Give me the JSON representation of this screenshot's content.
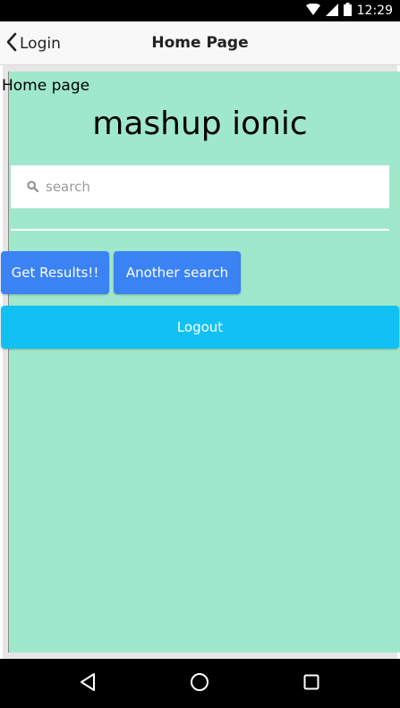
{
  "status_bar": {
    "time": "12:29",
    "icons": [
      "wifi-icon",
      "signal-icon",
      "battery-icon"
    ]
  },
  "nav_bar": {
    "back_label": "Login",
    "title": "Home Page"
  },
  "content": {
    "page_label": "Home page",
    "app_title": "mashup ionic",
    "search": {
      "placeholder": "search",
      "value": ""
    },
    "buttons": {
      "get_results": "Get Results!!",
      "another_search": "Another search",
      "logout": "Logout"
    }
  },
  "android_nav": {
    "keys": [
      "back-triangle-icon",
      "home-circle-icon",
      "recents-square-icon"
    ]
  },
  "colors": {
    "content_background": "#a0e8cb",
    "button_primary": "#3b82f4",
    "button_logout": "#11c1f3",
    "nav_bar_background": "#f8f8f8"
  }
}
